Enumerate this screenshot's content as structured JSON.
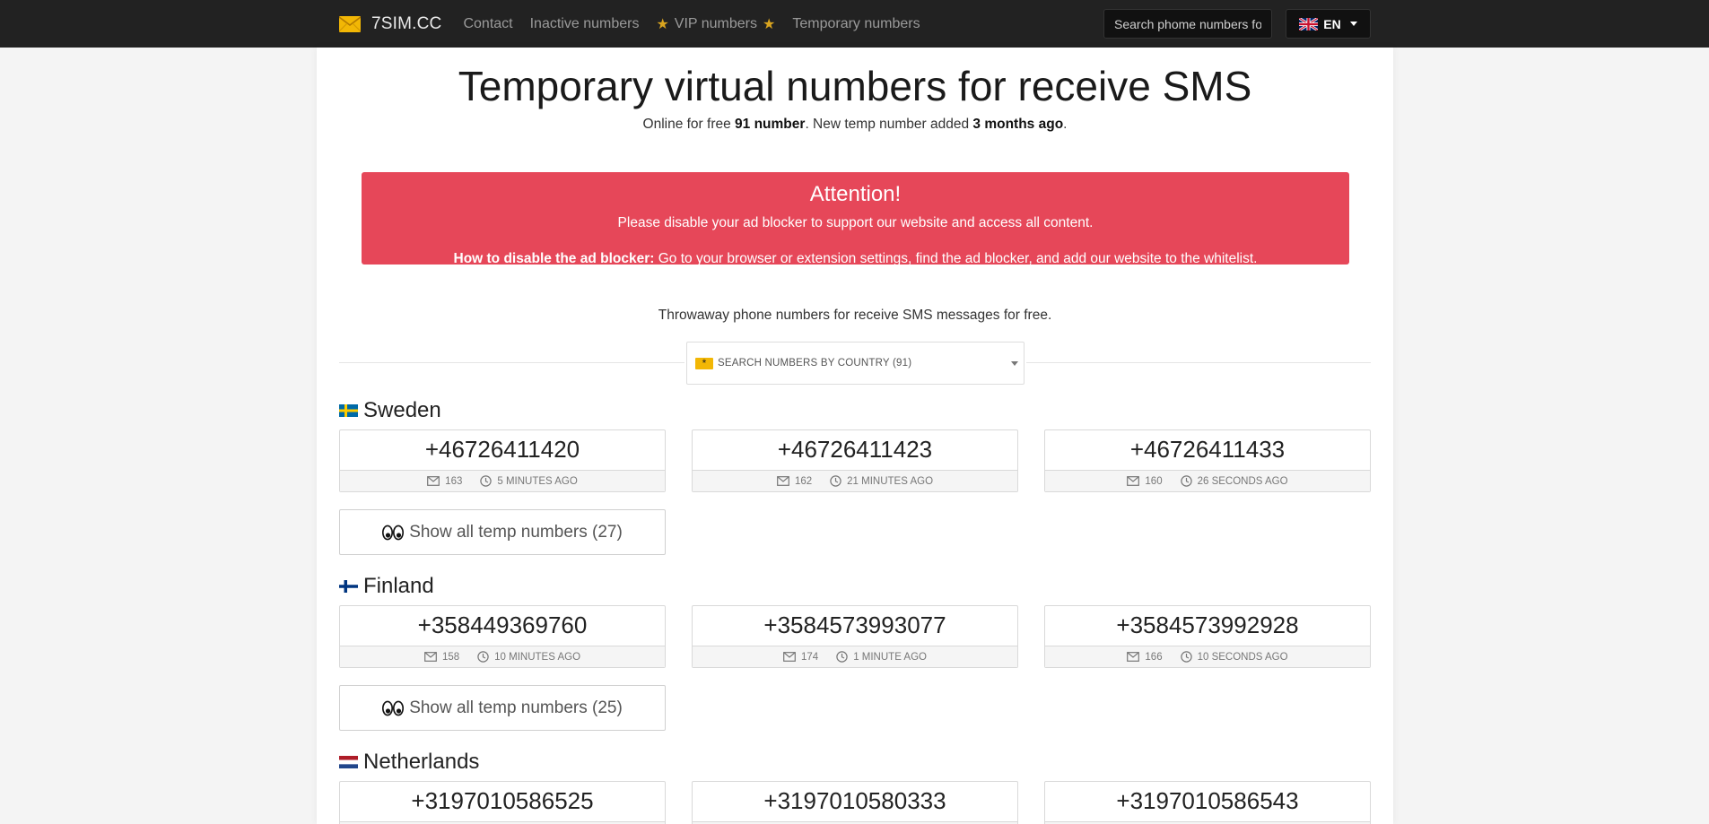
{
  "nav": {
    "brand": "7SIM.CC",
    "links": [
      "Contact",
      "Inactive numbers"
    ],
    "vip": "VIP numbers",
    "temporary": "Temporary numbers",
    "search_placeholder": "Search phome numbers fo",
    "lang": "EN"
  },
  "header": {
    "title": "Temporary virtual numbers for receive SMS",
    "sub_prefix": "Online for free ",
    "sub_count": "91 number",
    "sub_mid": ". New temp number added ",
    "sub_time": "3 months ago",
    "sub_end": "."
  },
  "alert": {
    "title": "Attention!",
    "text": "Please disable your ad blocker to support our website and access all content.",
    "howto_label": "How to disable the ad blocker:",
    "howto_text": " Go to your browser or extension settings, find the ad blocker, and add our website to the whitelist."
  },
  "tagline": "Throwaway phone numbers for receive SMS messages for free.",
  "country_select": "SEARCH NUMBERS BY COUNTRY (91)",
  "countries": [
    {
      "name": "Sweden",
      "numbers": [
        {
          "number": "+46726411420",
          "messages": "163",
          "time": "5 MINUTES AGO"
        },
        {
          "number": "+46726411423",
          "messages": "162",
          "time": "21 MINUTES AGO"
        },
        {
          "number": "+46726411433",
          "messages": "160",
          "time": "26 SECONDS AGO"
        }
      ],
      "show_all": "Show all temp numbers (27)"
    },
    {
      "name": "Finland",
      "numbers": [
        {
          "number": "+358449369760",
          "messages": "158",
          "time": "10 MINUTES AGO"
        },
        {
          "number": "+3584573993077",
          "messages": "174",
          "time": "1 MINUTE AGO"
        },
        {
          "number": "+3584573992928",
          "messages": "166",
          "time": "10 SECONDS AGO"
        }
      ],
      "show_all": "Show all temp numbers (25)"
    },
    {
      "name": "Netherlands",
      "numbers": [
        {
          "number": "+3197010586525"
        },
        {
          "number": "+3197010580333"
        },
        {
          "number": "+3197010586543"
        }
      ]
    }
  ],
  "colors": {
    "navbar": "#222222",
    "alert": "#e64759",
    "star": "#d9a41f"
  }
}
